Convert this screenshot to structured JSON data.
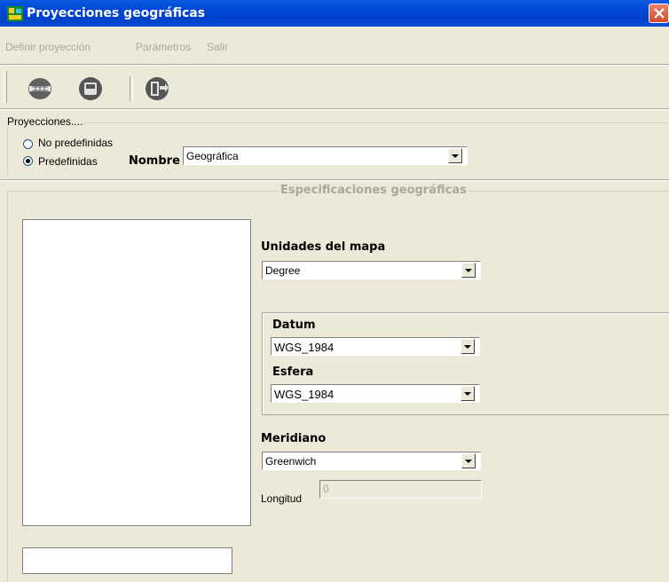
{
  "window": {
    "title": "Proyecciones geográficas"
  },
  "menu": {
    "items": [
      "Definir proyección",
      "Parámetros",
      "Salir"
    ]
  },
  "toolbar": {
    "icons": [
      "globe-icon",
      "save-icon",
      "exit-door-icon"
    ]
  },
  "projections_group": {
    "legend": "Proyecciones....",
    "radio_no_predef": "No predefinidas",
    "radio_predef": "Predefinidas",
    "selected": "Predefinidas",
    "name_label": "Nombre",
    "name_value": "Geográfica"
  },
  "geo_specs": {
    "legend": "Especificaciones geográficas",
    "units_label": "Unidades del mapa",
    "units_value": "Degree",
    "datum_label": "Datum",
    "datum_value": "WGS_1984",
    "sphere_label": "Esfera",
    "sphere_value": "WGS_1984",
    "meridian_label": "Meridiano",
    "meridian_value": "Greenwich",
    "longitude_label": "Longitud",
    "longitude_value": "0"
  },
  "colors": {
    "title_bar": "#0046d5",
    "face": "#ece9d8",
    "disabled_text": "#aca899"
  }
}
